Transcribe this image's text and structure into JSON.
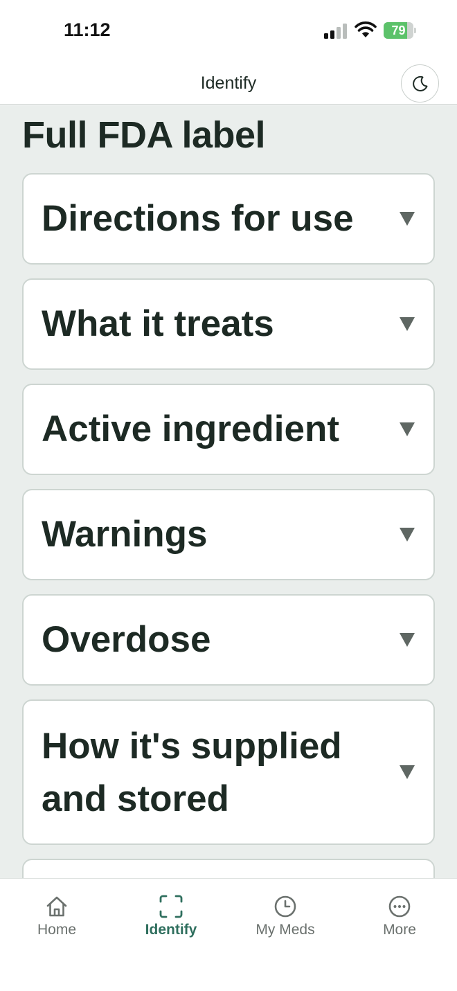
{
  "status_bar": {
    "time": "11:12",
    "battery_level": "79",
    "battery_fraction": 0.79
  },
  "header": {
    "title": "Identify",
    "theme_toggle_icon": "moon-icon"
  },
  "main": {
    "section_title": "Full FDA label",
    "accordion_items": [
      {
        "label": "Directions for use"
      },
      {
        "label": "What it treats"
      },
      {
        "label": "Active ingredient"
      },
      {
        "label": "Warnings"
      },
      {
        "label": "Overdose"
      },
      {
        "label": "How it's supplied and stored"
      }
    ]
  },
  "tab_bar": {
    "tabs": [
      {
        "label": "Home",
        "icon": "home-icon",
        "active": false
      },
      {
        "label": "Identify",
        "icon": "scan-icon",
        "active": true
      },
      {
        "label": "My Meds",
        "icon": "clock-icon",
        "active": false
      },
      {
        "label": "More",
        "icon": "more-icon",
        "active": false
      }
    ]
  },
  "colors": {
    "accent": "#2f6f5e",
    "content_background": "#eaeeec",
    "text": "#1d2a24"
  }
}
